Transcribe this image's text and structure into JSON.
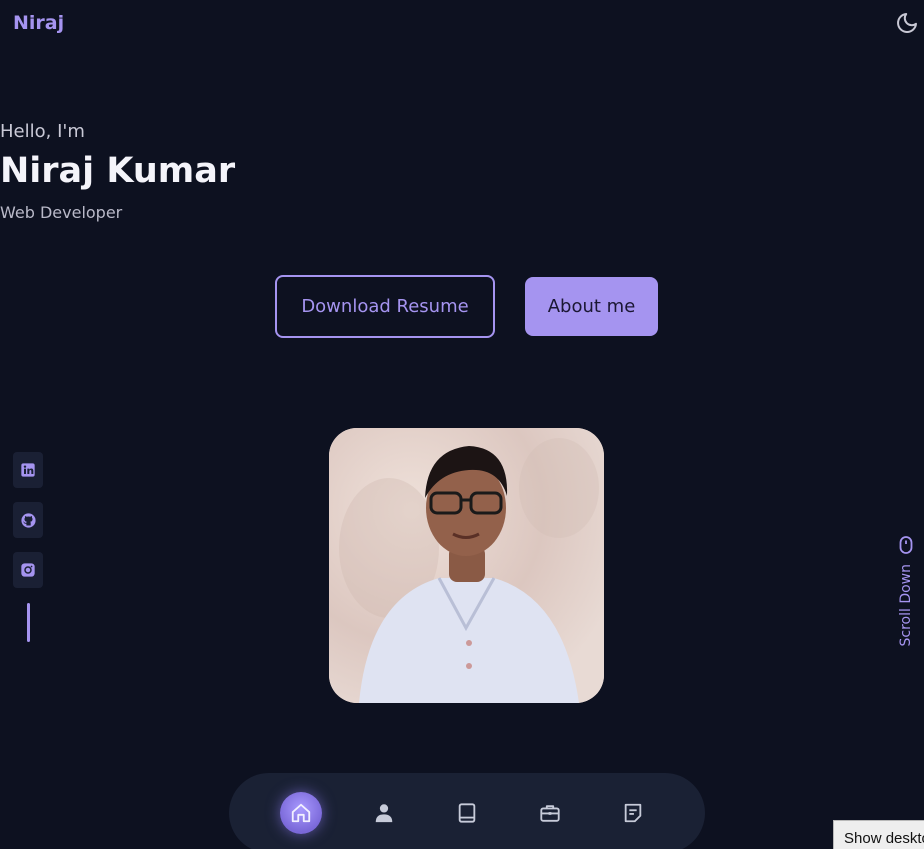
{
  "header": {
    "logo": "Niraj",
    "theme_icon": "moon-icon"
  },
  "hero": {
    "greeting": "Hello, I'm",
    "name": "Niraj Kumar",
    "role": "Web Developer",
    "download_label": "Download Resume",
    "about_label": "About me"
  },
  "socials": [
    {
      "icon": "linkedin-icon"
    },
    {
      "icon": "github-icon"
    },
    {
      "icon": "instagram-icon"
    }
  ],
  "scroll": {
    "label": "Scroll Down",
    "icon": "mouse-icon"
  },
  "nav": [
    {
      "icon": "home-icon",
      "active": true
    },
    {
      "icon": "user-icon",
      "active": false
    },
    {
      "icon": "book-icon",
      "active": false
    },
    {
      "icon": "briefcase-icon",
      "active": false
    },
    {
      "icon": "message-icon",
      "active": false
    }
  ],
  "tooltip": {
    "text": "Show desktop"
  },
  "colors": {
    "background": "#0d1120",
    "accent": "#a594f0",
    "surface": "#1a2134"
  }
}
